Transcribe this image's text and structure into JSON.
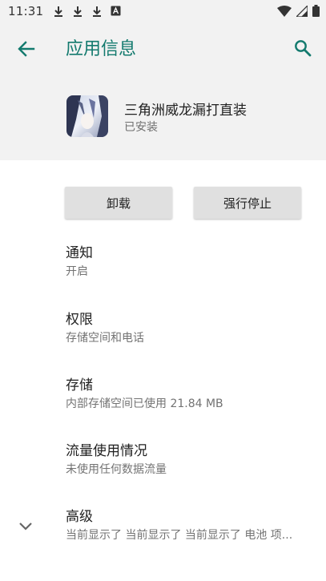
{
  "status_bar": {
    "time": "11:31"
  },
  "app_bar": {
    "title": "应用信息"
  },
  "app": {
    "name": "三角洲威龙漏打直装",
    "status": "已安装"
  },
  "buttons": {
    "uninstall": "卸载",
    "force_stop": "强行停止"
  },
  "settings": [
    {
      "title": "通知",
      "subtitle": "开启"
    },
    {
      "title": "权限",
      "subtitle": "存储空间和电话"
    },
    {
      "title": "存储",
      "subtitle": "内部存储空间已使用 21.84 MB"
    },
    {
      "title": "流量使用情况",
      "subtitle": "未使用任何数据流量"
    },
    {
      "title": "高级",
      "subtitle": "当前显示了 当前显示了 当前显示了 电池 项..."
    }
  ],
  "colors": {
    "accent": "#137a6e",
    "header_bg": "#f2f2f2",
    "button_bg": "#e0e0e0"
  }
}
